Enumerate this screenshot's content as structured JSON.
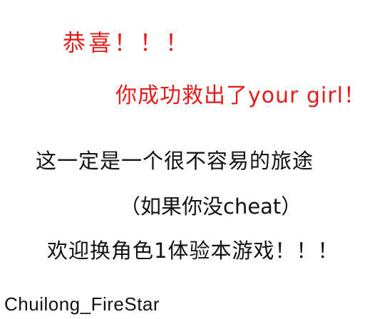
{
  "colors": {
    "accent": "#e31b1b",
    "text": "#111111",
    "background": "#ffffff"
  },
  "ending_screen": {
    "congrats": "恭喜！！！",
    "rescued": "你成功救出了your girl！",
    "journey": "这一定是一个很不容易的旅途",
    "cheat_note": "（如果你没cheat）",
    "switch_character": "欢迎换角色1体验本游戏！！！",
    "author": "Chuilong_FireStar"
  }
}
